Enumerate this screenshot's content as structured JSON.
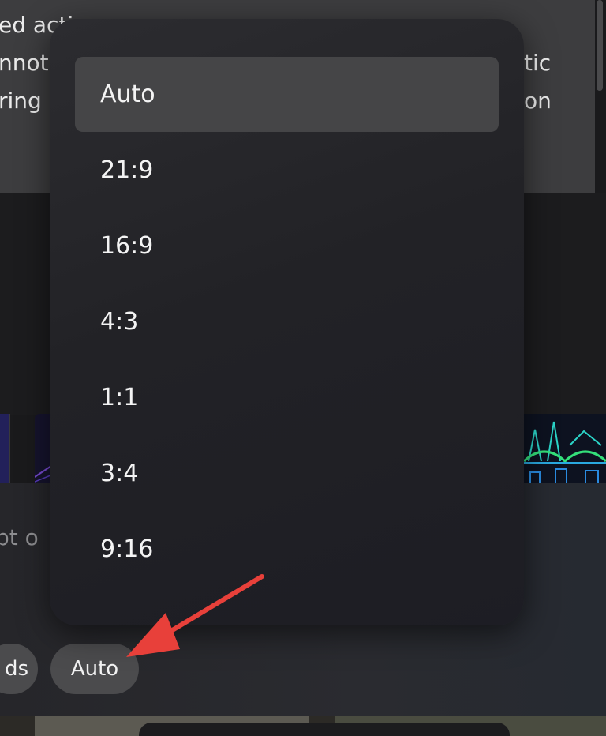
{
  "background": {
    "text_lines": [
      "ed acti",
      "nnot",
      "ring"
    ],
    "text_lines_right": [
      "tic",
      "on"
    ],
    "prompt_placeholder": "pt o"
  },
  "dropdown": {
    "options": [
      {
        "label": "Auto",
        "selected": true
      },
      {
        "label": "21:9",
        "selected": false
      },
      {
        "label": "16:9",
        "selected": false
      },
      {
        "label": "4:3",
        "selected": false
      },
      {
        "label": "1:1",
        "selected": false
      },
      {
        "label": "3:4",
        "selected": false
      },
      {
        "label": "9:16",
        "selected": false
      }
    ]
  },
  "toolbar": {
    "left_chip_label": "ds",
    "aspect_chip_label": "Auto"
  },
  "colors": {
    "annotation_arrow": "#e8403a",
    "selected_option_bg": "#454547",
    "chip_bg": "#4b4b4d"
  }
}
